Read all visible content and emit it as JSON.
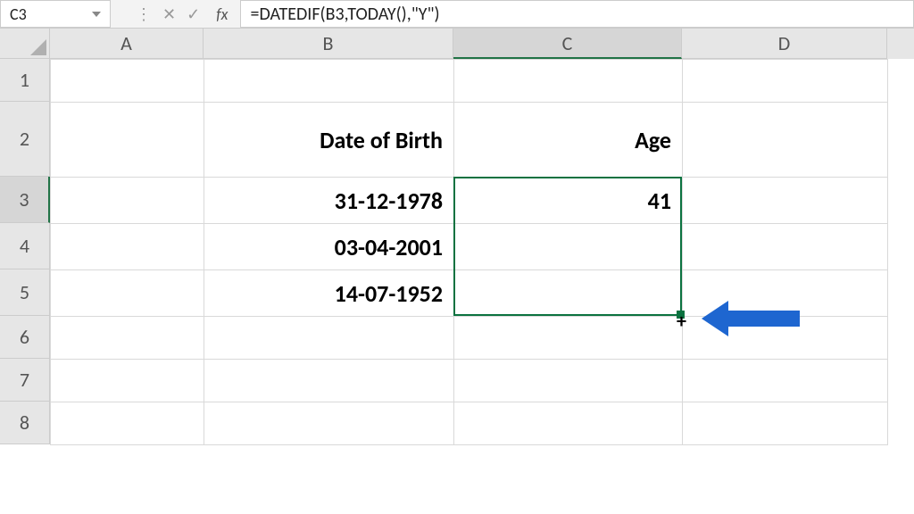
{
  "formula_bar": {
    "cell_ref": "C3",
    "formula": "=DATEDIF(B3,TODAY(),\"Y\")"
  },
  "columns": [
    "A",
    "B",
    "C",
    "D"
  ],
  "rows": [
    "1",
    "2",
    "3",
    "4",
    "5",
    "6",
    "7",
    "8"
  ],
  "headers": {
    "b2": "Date of Birth",
    "c2": "Age"
  },
  "data": {
    "b3": "31-12-1978",
    "b4": "03-04-2001",
    "b5": "14-07-1952",
    "c3": "41",
    "c4": "",
    "c5": ""
  },
  "selection": {
    "active_cell": "C3",
    "range": "C3:C5"
  },
  "colors": {
    "header_bg": "#1e66d0",
    "selection_border": "#0b7240",
    "arrow": "#1e66d0"
  }
}
